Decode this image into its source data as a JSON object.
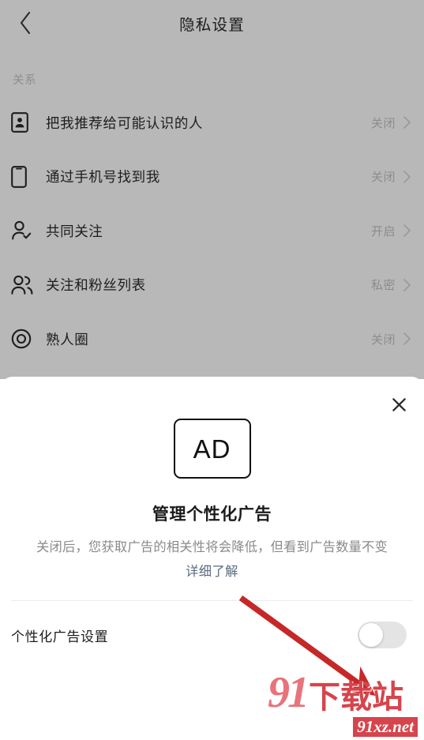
{
  "navbar": {
    "back_icon": "chevron-left-icon",
    "title": "隐私设置"
  },
  "settings": {
    "section_header": "关系",
    "rows": [
      {
        "icon": "contact-card-icon",
        "label": "把我推荐给可能认识的人",
        "value": "关闭",
        "chevron": "chevron-right-icon"
      },
      {
        "icon": "phone-icon",
        "label": "通过手机号找到我",
        "value": "关闭",
        "chevron": "chevron-right-icon"
      },
      {
        "icon": "person-check-icon",
        "label": "共同关注",
        "value": "开启",
        "chevron": "chevron-right-icon"
      },
      {
        "icon": "people-group-icon",
        "label": "关注和粉丝列表",
        "value": "私密",
        "chevron": "chevron-right-icon"
      },
      {
        "icon": "target-circle-icon",
        "label": "熟人圈",
        "value": "关闭",
        "chevron": "chevron-right-icon"
      }
    ]
  },
  "sheet": {
    "close_icon": "close-icon",
    "badge_text": "AD",
    "title": "管理个性化广告",
    "description": "关闭后，您获取广告的相关性将会降低，但看到广告数量不变",
    "link": "详细了解",
    "setting_label": "个性化广告设置",
    "toggle_state": "off"
  },
  "annotation": {
    "arrow_color": "#c62828",
    "arrow_from": "305,757",
    "arrow_to": "462,872"
  },
  "watermark": {
    "brand_number": "91",
    "brand_cn": "下载站",
    "url": "91xz.net",
    "color": "#d6444c"
  },
  "colors": {
    "overlay_background": "#b8b8b8",
    "sheet_background": "#ffffff",
    "primary_text": "#1b1b1b",
    "secondary_text": "#8a8a8a",
    "link_text": "#5b6b82",
    "accent_red": "#c62828"
  }
}
